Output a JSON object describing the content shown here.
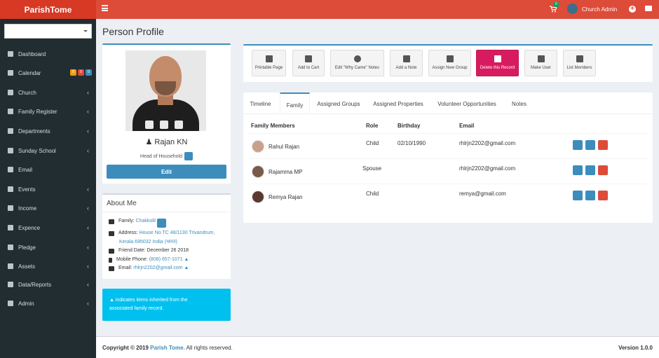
{
  "brand": "ParishTome",
  "header": {
    "cart_badge": "0",
    "user_name": "Church Admin"
  },
  "sidebar": {
    "items": [
      {
        "label": "Dashboard",
        "icon": "dashboard-icon"
      },
      {
        "label": "Calendar",
        "icon": "calendar-icon",
        "badges": [
          "0",
          "0",
          "0"
        ]
      },
      {
        "label": "Church",
        "icon": "church-icon"
      },
      {
        "label": "Family Register",
        "icon": "users-icon"
      },
      {
        "label": "Departments",
        "icon": "sitemap-icon"
      },
      {
        "label": "Sunday School",
        "icon": "child-icon"
      },
      {
        "label": "Email",
        "icon": "envelope-icon"
      },
      {
        "label": "Events",
        "icon": "ticket-icon"
      },
      {
        "label": "Income",
        "icon": "share-icon"
      },
      {
        "label": "Expence",
        "icon": "reply-icon"
      },
      {
        "label": "Pledge",
        "icon": "reply-icon"
      },
      {
        "label": "Assets",
        "icon": "car-icon"
      },
      {
        "label": "Data/Reports",
        "icon": "chart-icon"
      },
      {
        "label": "Admin",
        "icon": "gears-icon"
      }
    ]
  },
  "page_title": "Person Profile",
  "profile": {
    "name": "Rajan KN",
    "role": "Head of Household",
    "edit_label": "Edit"
  },
  "about": {
    "title": "About Me",
    "family_label": "Family:",
    "family_value": "Chakkolil",
    "address_label": "Address:",
    "address_line1": "House No TC 48/1130 Trivandrum,",
    "address_line2": "Kerala 695032 India (भारत)",
    "friend_date": "Friend Date: December 26 2018",
    "mobile_label": "Mobile Phone:",
    "mobile_value": "(808) 657-1071",
    "email_label": "Email:",
    "email_value": "rhlrjn2202@gmail.com"
  },
  "info_note": {
    "line1": "indicates items inherited from the",
    "line2": "associated family record."
  },
  "actions": [
    "Printable Page",
    "Add to Cart",
    "Edit \"Why Came\" Notes",
    "Add a Note",
    "Assign New Group",
    "Delete this Record",
    "Make User",
    "List Members"
  ],
  "tabs": [
    "Timeline",
    "Family",
    "Assigned Groups",
    "Assigned Properties",
    "Volunteer Opportunities",
    "Notes"
  ],
  "family_table": {
    "headers": [
      "Family Members",
      "Role",
      "Birthday",
      "Email"
    ],
    "rows": [
      {
        "name": "Rahul Rajan",
        "role": "Child",
        "birthday": "02/10/1990",
        "email": "rhlrjn2202@gmail.com"
      },
      {
        "name": "Rajamma MP",
        "role": "Spouse",
        "birthday": "",
        "email": "rhlrjn2202@gmail.com"
      },
      {
        "name": "Remya Rajan",
        "role": "Child",
        "birthday": "",
        "email": "remya@gmail.com"
      }
    ]
  },
  "footer": {
    "copyright_prefix": "Copyright © 2019",
    "copyright_brand": "Parish Tome.",
    "copyright_suffix": "All rights reserved.",
    "version": "Version 1.0.0"
  }
}
